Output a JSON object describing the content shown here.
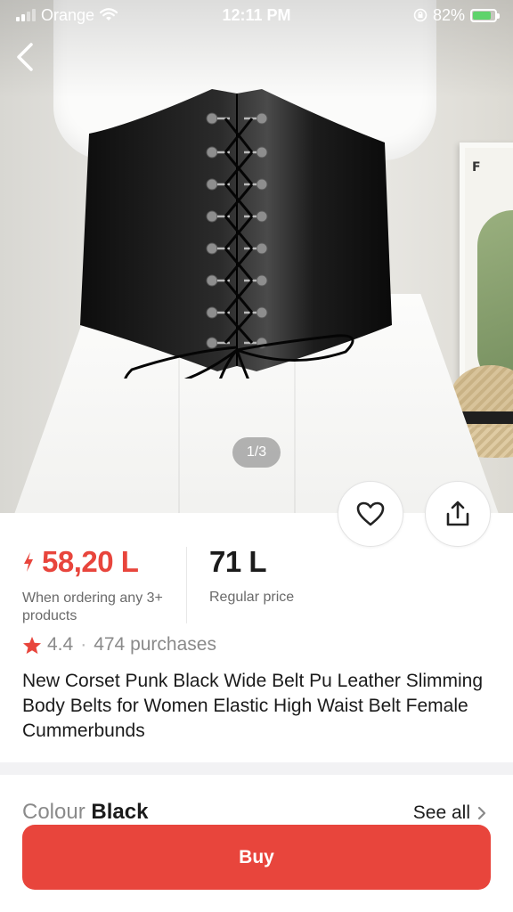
{
  "status_bar": {
    "carrier": "Orange",
    "time": "12:11 PM",
    "battery": "82%"
  },
  "gallery": {
    "counter": "1/3",
    "frame_text": "F"
  },
  "price": {
    "sale": "58,20 L",
    "sale_note": "When ordering any 3+ products",
    "regular": "71 L",
    "regular_note": "Regular price"
  },
  "rating": {
    "value": "4.4",
    "separator": "·",
    "purchases": "474 purchases"
  },
  "product": {
    "title": "New Corset Punk Black Wide Belt Pu Leather Slimming Body Belts for Women Elastic High Waist Belt Female Cummerbunds"
  },
  "variant": {
    "label": "Colour",
    "value": "Black",
    "see_all": "See all"
  },
  "actions": {
    "buy": "Buy"
  },
  "colors": {
    "accent": "#e8453c",
    "muted": "#8a8a8a"
  },
  "icons": [
    "back-arrow-icon",
    "heart-icon",
    "share-icon",
    "bolt-icon",
    "star-icon",
    "chevron-right-icon",
    "wifi-icon",
    "signal-icon",
    "battery-icon",
    "rotation-lock-icon"
  ]
}
